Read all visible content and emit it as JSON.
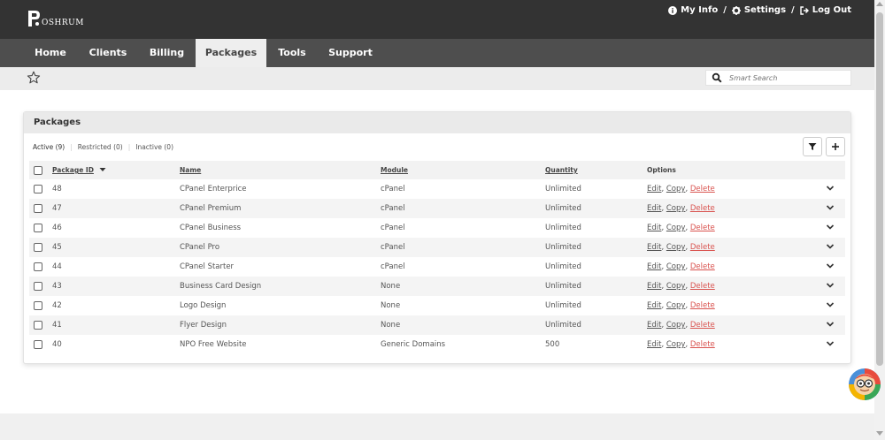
{
  "brand": {
    "logo_text": "OSHRUM"
  },
  "top_links": [
    {
      "label": "My Info",
      "icon": "info-circle-icon"
    },
    {
      "label": "Settings",
      "icon": "gear-icon"
    },
    {
      "label": "Log Out",
      "icon": "logout-icon"
    }
  ],
  "top_separator": "/",
  "nav": [
    {
      "label": "Home",
      "active": false
    },
    {
      "label": "Clients",
      "active": false
    },
    {
      "label": "Billing",
      "active": false
    },
    {
      "label": "Packages",
      "active": true
    },
    {
      "label": "Tools",
      "active": false
    },
    {
      "label": "Support",
      "active": false
    }
  ],
  "search": {
    "placeholder": "Smart Search",
    "value": ""
  },
  "panel": {
    "title": "Packages",
    "filters": [
      "Active (9)",
      "Restricted (0)",
      "Inactive (0)"
    ],
    "filter_separator": "|",
    "columns": [
      "Package ID",
      "Name",
      "Module",
      "Quantity",
      "Options"
    ],
    "option_links": [
      "Edit",
      "Copy",
      "Delete"
    ],
    "rows": [
      {
        "id": "48",
        "name": "CPanel Enterprice",
        "module": "cPanel",
        "quantity": "Unlimited"
      },
      {
        "id": "47",
        "name": "CPanel Premium",
        "module": "cPanel",
        "quantity": "Unlimited"
      },
      {
        "id": "46",
        "name": "CPanel Business",
        "module": "cPanel",
        "quantity": "Unlimited"
      },
      {
        "id": "45",
        "name": "CPanel Pro",
        "module": "cPanel",
        "quantity": "Unlimited"
      },
      {
        "id": "44",
        "name": "CPanel Starter",
        "module": "cPanel",
        "quantity": "Unlimited"
      },
      {
        "id": "43",
        "name": "Business Card Design",
        "module": "None",
        "quantity": "Unlimited"
      },
      {
        "id": "42",
        "name": "Logo Design",
        "module": "None",
        "quantity": "Unlimited"
      },
      {
        "id": "41",
        "name": "Flyer Design",
        "module": "None",
        "quantity": "Unlimited"
      },
      {
        "id": "40",
        "name": "NPO Free Website",
        "module": "Generic Domains",
        "quantity": "500"
      }
    ]
  },
  "colors": {
    "topbar": "#333333",
    "navbar": "#4e4e4e",
    "delete_link": "#d9534f",
    "panel_header": "#eaeaea"
  }
}
